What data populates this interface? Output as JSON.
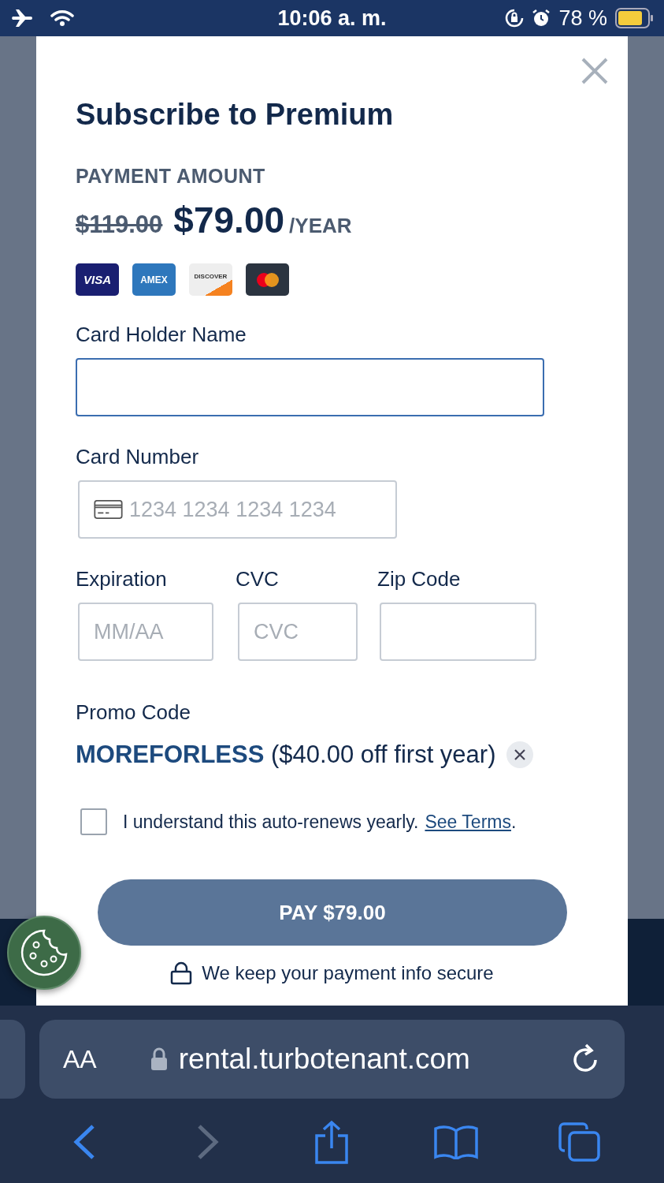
{
  "status_bar": {
    "time": "10:06 a. m.",
    "battery": "78 %"
  },
  "modal": {
    "title": "Subscribe to Premium",
    "amount_label": "PAYMENT AMOUNT",
    "old_price": "$119.00",
    "price": "$79.00",
    "period": "/YEAR",
    "card_brands": [
      {
        "kind": "visa",
        "label": "VISA"
      },
      {
        "kind": "amex",
        "label": "AMEX"
      },
      {
        "kind": "discover",
        "label": "DISCOVER"
      },
      {
        "kind": "mastercard"
      }
    ],
    "holder": {
      "label": "Card Holder Name",
      "focused": true
    },
    "number": {
      "label": "Card Number",
      "placeholder": "1234 1234 1234 1234",
      "focused": false
    },
    "row_fields": [
      {
        "label": "Expiration",
        "placeholder": "MM/AA",
        "focused": false
      },
      {
        "label": "CVC",
        "placeholder": "CVC",
        "focused": false
      },
      {
        "label": "Zip Code",
        "focused": false
      }
    ],
    "promo": {
      "label": "Promo Code",
      "code": "MOREFORLESS",
      "description": "($40.00 off first year)"
    },
    "terms": {
      "checked": false,
      "text": "I understand this auto-renews yearly.",
      "link": "See Terms",
      "suffix": "."
    },
    "pay_button": "PAY $79.00",
    "secure_note": "We keep your payment info secure"
  },
  "browser": {
    "text_size": "AA",
    "url": "rental.turbotenant.com",
    "back_enabled": true,
    "forward_enabled": false
  }
}
